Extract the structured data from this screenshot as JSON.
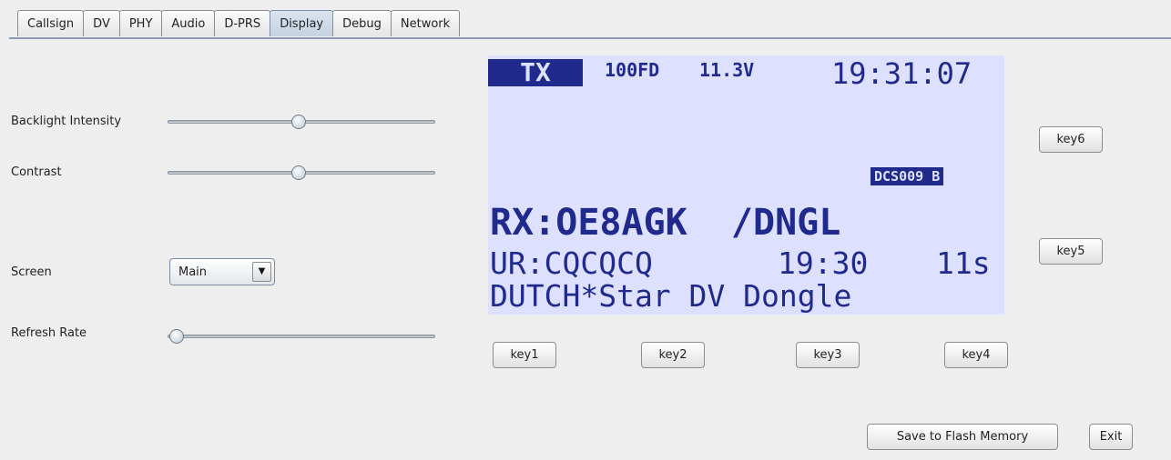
{
  "tabs": [
    {
      "label": "Callsign",
      "active": false
    },
    {
      "label": "DV",
      "active": false
    },
    {
      "label": "PHY",
      "active": false
    },
    {
      "label": "Audio",
      "active": false
    },
    {
      "label": "D-PRS",
      "active": false
    },
    {
      "label": "Display",
      "active": true
    },
    {
      "label": "Debug",
      "active": false
    },
    {
      "label": "Network",
      "active": false
    }
  ],
  "settings": {
    "backlight": {
      "label": "Backlight Intensity",
      "level": 0.49
    },
    "contrast": {
      "label": "Contrast",
      "level": 0.49
    },
    "screen": {
      "label": "Screen",
      "value": "Main"
    },
    "refresh": {
      "label": "Refresh Rate",
      "level": 0.0
    }
  },
  "lcd": {
    "tx": "TX",
    "code": "100FD",
    "voltage": "11.3V",
    "time": "19:31:07",
    "status": "DCS009 B",
    "rx_line": "RX:OE8AGK  /DNGL",
    "ur_call": "UR:CQCQCQ",
    "ur_time": "19:30",
    "ur_dur": "11s",
    "message": "DUTCH*Star DV Dongle",
    "bg_color": "#dde0ff",
    "fg_color": "#1f2a8c"
  },
  "keys": {
    "key1": "key1",
    "key2": "key2",
    "key3": "key3",
    "key4": "key4",
    "key5": "key5",
    "key6": "key6"
  },
  "footer": {
    "save_label": "Save to Flash Memory",
    "exit_label": "Exit"
  },
  "icons": {
    "dropdown": "triangle-down"
  }
}
